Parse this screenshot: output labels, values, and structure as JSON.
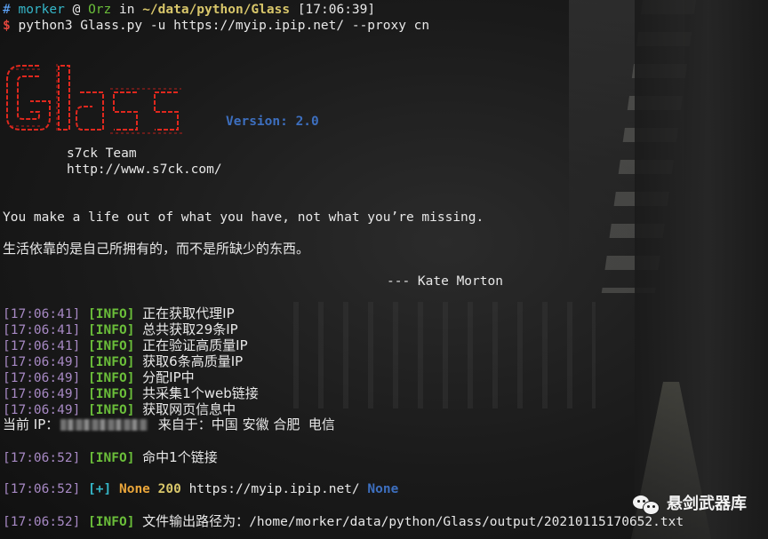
{
  "prompt": {
    "hash": "#",
    "user": "morker",
    "at": "@",
    "host": "Orz",
    "in": "in",
    "path": "~/data/python/Glass",
    "time": "[17:06:39]"
  },
  "command": {
    "dollar": "$",
    "text": "python3 Glass.py -u https://myip.ipip.net/ --proxy cn"
  },
  "banner": {
    "logo_text": "Glass",
    "version": "Version: 2.0",
    "team": "s7ck Team",
    "url": "http://www.s7ck.com/",
    "quote_en": "You make a life out of what you have, not what you’re missing.",
    "quote_cn": "生活依靠的是自己所拥有的，而不是所缺少的东西。",
    "author": "--- Kate Morton"
  },
  "logs": [
    {
      "time": "[17:06:41]",
      "tag": "[INFO]",
      "msg": "正在获取代理IP"
    },
    {
      "time": "[17:06:41]",
      "tag": "[INFO]",
      "msg": "总共获取29条IP"
    },
    {
      "time": "[17:06:41]",
      "tag": "[INFO]",
      "msg": "正在验证高质量IP"
    },
    {
      "time": "[17:06:49]",
      "tag": "[INFO]",
      "msg": "获取6条高质量IP"
    },
    {
      "time": "[17:06:49]",
      "tag": "[INFO]",
      "msg": "分配IP中"
    },
    {
      "time": "[17:06:49]",
      "tag": "[INFO]",
      "msg": "共采集1个web链接"
    },
    {
      "time": "[17:06:49]",
      "tag": "[INFO]",
      "msg": "获取网页信息中"
    }
  ],
  "current_ip": {
    "label": "当前 IP：",
    "from": "来自于：中国 安徽 合肥  电信"
  },
  "hit": {
    "time": "[17:06:52]",
    "tag": "[INFO]",
    "msg": "命中1个链接"
  },
  "result": {
    "time": "[17:06:52]",
    "tag": "[+]",
    "status_word": "None",
    "code": "200",
    "url": "https://myip.ipip.net/",
    "title": "None"
  },
  "output": {
    "time": "[17:06:52]",
    "tag": "[INFO]",
    "msg": "文件输出路径为：",
    "path": "/home/morker/data/python/Glass/output/20210115170652.txt"
  },
  "watermark": {
    "text": "悬剑武器库",
    "icon": "wechat-icon"
  }
}
